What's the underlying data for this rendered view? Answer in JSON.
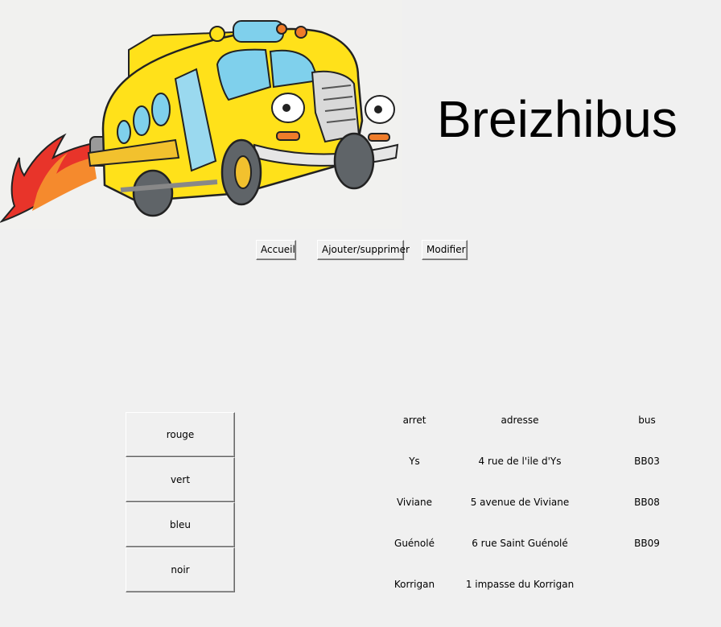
{
  "app": {
    "title": "Breizhibus"
  },
  "nav": {
    "home": "Accueil",
    "add_remove": "Ajouter/supprimer",
    "edit": "Modifier"
  },
  "colors": {
    "buttons": [
      "rouge",
      "vert",
      "bleu",
      "noir"
    ]
  },
  "table": {
    "headers": {
      "stop": "arret",
      "address": "adresse",
      "bus": "bus"
    },
    "rows": [
      {
        "stop": "Ys",
        "address": "4 rue de l'ile d'Ys",
        "bus": "BB03"
      },
      {
        "stop": "Viviane",
        "address": "5 avenue de Viviane",
        "bus": "BB08"
      },
      {
        "stop": "Guénolé",
        "address": "6 rue Saint Guénolé",
        "bus": "BB09"
      },
      {
        "stop": "Korrigan",
        "address": "1 impasse du Korrigan",
        "bus": ""
      }
    ]
  },
  "theme": {
    "background": "#f0f0f0",
    "bus_yellow": "#ffe11a",
    "flame_red": "#e8342a",
    "flame_orange": "#f58a2d"
  }
}
